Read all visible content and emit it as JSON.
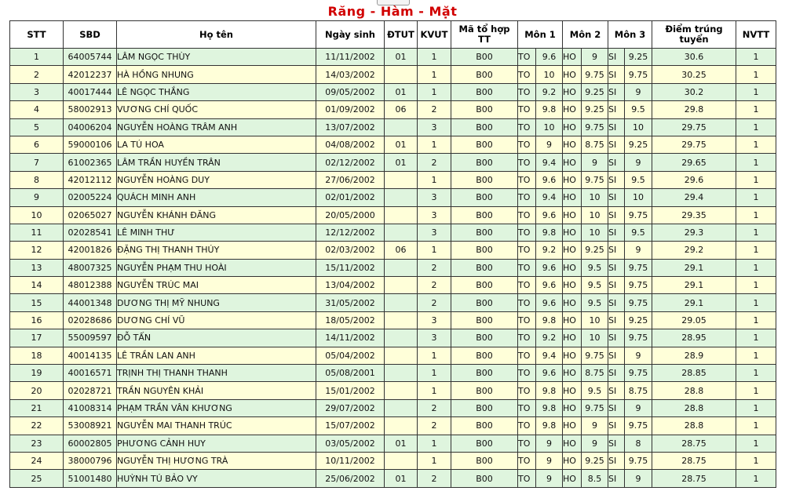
{
  "page": {
    "title": "Răng - Hàm - Mặt"
  },
  "table": {
    "headers": {
      "stt": "STT",
      "sbd": "SBD",
      "name": "Họ tên",
      "dob": "Ngày sinh",
      "dtut": "ĐTUT",
      "kvut": "KVUT",
      "combo": "Mã tổ hợp TT",
      "mon1": "Môn 1",
      "mon2": "Môn 2",
      "mon3": "Môn 3",
      "diem": "Điểm trúng tuyển",
      "nvtt": "NVTT"
    },
    "rows": [
      {
        "stt": "1",
        "sbd": "64005744",
        "name": "LÂM NGỌC THÙY",
        "dob": "11/11/2002",
        "dtut": "01",
        "kvut": "1",
        "combo": "B00",
        "m1": "TO",
        "s1": "9.6",
        "m2": "HO",
        "s2": "9",
        "m3": "SI",
        "s3": "9.25",
        "diem": "30.6",
        "nvtt": "1"
      },
      {
        "stt": "2",
        "sbd": "42012237",
        "name": "HÀ HỒNG NHUNG",
        "dob": "14/03/2002",
        "dtut": "",
        "kvut": "1",
        "combo": "B00",
        "m1": "TO",
        "s1": "10",
        "m2": "HO",
        "s2": "9.75",
        "m3": "SI",
        "s3": "9.75",
        "diem": "30.25",
        "nvtt": "1"
      },
      {
        "stt": "3",
        "sbd": "40017444",
        "name": "LÊ NGỌC THẮNG",
        "dob": "09/05/2002",
        "dtut": "01",
        "kvut": "1",
        "combo": "B00",
        "m1": "TO",
        "s1": "9.2",
        "m2": "HO",
        "s2": "9.25",
        "m3": "SI",
        "s3": "9",
        "diem": "30.2",
        "nvtt": "1"
      },
      {
        "stt": "4",
        "sbd": "58002913",
        "name": "VƯƠNG CHÍ QUỐC",
        "dob": "01/09/2002",
        "dtut": "06",
        "kvut": "2",
        "combo": "B00",
        "m1": "TO",
        "s1": "9.8",
        "m2": "HO",
        "s2": "9.25",
        "m3": "SI",
        "s3": "9.5",
        "diem": "29.8",
        "nvtt": "1"
      },
      {
        "stt": "5",
        "sbd": "04006204",
        "name": "NGUYỄN HOÀNG TRÂM ANH",
        "dob": "13/07/2002",
        "dtut": "",
        "kvut": "3",
        "combo": "B00",
        "m1": "TO",
        "s1": "10",
        "m2": "HO",
        "s2": "9.75",
        "m3": "SI",
        "s3": "10",
        "diem": "29.75",
        "nvtt": "1"
      },
      {
        "stt": "6",
        "sbd": "59000106",
        "name": "LA TÚ HOA",
        "dob": "04/08/2002",
        "dtut": "01",
        "kvut": "1",
        "combo": "B00",
        "m1": "TO",
        "s1": "9",
        "m2": "HO",
        "s2": "8.75",
        "m3": "SI",
        "s3": "9.25",
        "diem": "29.75",
        "nvtt": "1"
      },
      {
        "stt": "7",
        "sbd": "61002365",
        "name": "LÂM TRẦN HUYỀN TRÂN",
        "dob": "02/12/2002",
        "dtut": "01",
        "kvut": "2",
        "combo": "B00",
        "m1": "TO",
        "s1": "9.4",
        "m2": "HO",
        "s2": "9",
        "m3": "SI",
        "s3": "9",
        "diem": "29.65",
        "nvtt": "1"
      },
      {
        "stt": "8",
        "sbd": "42012112",
        "name": "NGUYỄN HOÀNG DUY",
        "dob": "27/06/2002",
        "dtut": "",
        "kvut": "1",
        "combo": "B00",
        "m1": "TO",
        "s1": "9.6",
        "m2": "HO",
        "s2": "9.75",
        "m3": "SI",
        "s3": "9.5",
        "diem": "29.6",
        "nvtt": "1"
      },
      {
        "stt": "9",
        "sbd": "02005224",
        "name": "QUÁCH MINH ANH",
        "dob": "02/01/2002",
        "dtut": "",
        "kvut": "3",
        "combo": "B00",
        "m1": "TO",
        "s1": "9.4",
        "m2": "HO",
        "s2": "10",
        "m3": "SI",
        "s3": "10",
        "diem": "29.4",
        "nvtt": "1"
      },
      {
        "stt": "10",
        "sbd": "02065027",
        "name": "NGUYỄN KHÁNH ĐĂNG",
        "dob": "20/05/2000",
        "dtut": "",
        "kvut": "3",
        "combo": "B00",
        "m1": "TO",
        "s1": "9.6",
        "m2": "HO",
        "s2": "10",
        "m3": "SI",
        "s3": "9.75",
        "diem": "29.35",
        "nvtt": "1"
      },
      {
        "stt": "11",
        "sbd": "02028541",
        "name": "LÊ MINH THƯ",
        "dob": "12/12/2002",
        "dtut": "",
        "kvut": "3",
        "combo": "B00",
        "m1": "TO",
        "s1": "9.8",
        "m2": "HO",
        "s2": "10",
        "m3": "SI",
        "s3": "9.5",
        "diem": "29.3",
        "nvtt": "1"
      },
      {
        "stt": "12",
        "sbd": "42001826",
        "name": "ĐẶNG THỊ THANH THÚY",
        "dob": "02/03/2002",
        "dtut": "06",
        "kvut": "1",
        "combo": "B00",
        "m1": "TO",
        "s1": "9.2",
        "m2": "HO",
        "s2": "9.25",
        "m3": "SI",
        "s3": "9",
        "diem": "29.2",
        "nvtt": "1"
      },
      {
        "stt": "13",
        "sbd": "48007325",
        "name": "NGUYỄN PHẠM THU HOÀI",
        "dob": "15/11/2002",
        "dtut": "",
        "kvut": "2",
        "combo": "B00",
        "m1": "TO",
        "s1": "9.6",
        "m2": "HO",
        "s2": "9.5",
        "m3": "SI",
        "s3": "9.75",
        "diem": "29.1",
        "nvtt": "1"
      },
      {
        "stt": "14",
        "sbd": "48012388",
        "name": "NGUYỄN TRÚC MAI",
        "dob": "13/04/2002",
        "dtut": "",
        "kvut": "2",
        "combo": "B00",
        "m1": "TO",
        "s1": "9.6",
        "m2": "HO",
        "s2": "9.5",
        "m3": "SI",
        "s3": "9.75",
        "diem": "29.1",
        "nvtt": "1"
      },
      {
        "stt": "15",
        "sbd": "44001348",
        "name": "DƯƠNG THỊ MỸ NHUNG",
        "dob": "31/05/2002",
        "dtut": "",
        "kvut": "2",
        "combo": "B00",
        "m1": "TO",
        "s1": "9.6",
        "m2": "HO",
        "s2": "9.5",
        "m3": "SI",
        "s3": "9.75",
        "diem": "29.1",
        "nvtt": "1"
      },
      {
        "stt": "16",
        "sbd": "02028686",
        "name": "DƯƠNG CHÍ VŨ",
        "dob": "18/05/2002",
        "dtut": "",
        "kvut": "3",
        "combo": "B00",
        "m1": "TO",
        "s1": "9.8",
        "m2": "HO",
        "s2": "10",
        "m3": "SI",
        "s3": "9.25",
        "diem": "29.05",
        "nvtt": "1"
      },
      {
        "stt": "17",
        "sbd": "55009597",
        "name": "ĐỖ TẤN",
        "dob": "14/11/2002",
        "dtut": "",
        "kvut": "3",
        "combo": "B00",
        "m1": "TO",
        "s1": "9.2",
        "m2": "HO",
        "s2": "10",
        "m3": "SI",
        "s3": "9.75",
        "diem": "28.95",
        "nvtt": "1"
      },
      {
        "stt": "18",
        "sbd": "40014135",
        "name": "LÊ TRẦN LAN ANH",
        "dob": "05/04/2002",
        "dtut": "",
        "kvut": "1",
        "combo": "B00",
        "m1": "TO",
        "s1": "9.4",
        "m2": "HO",
        "s2": "9.75",
        "m3": "SI",
        "s3": "9",
        "diem": "28.9",
        "nvtt": "1"
      },
      {
        "stt": "19",
        "sbd": "40016571",
        "name": "TRỊNH THỊ THANH THANH",
        "dob": "05/08/2001",
        "dtut": "",
        "kvut": "1",
        "combo": "B00",
        "m1": "TO",
        "s1": "9.6",
        "m2": "HO",
        "s2": "8.75",
        "m3": "SI",
        "s3": "9.75",
        "diem": "28.85",
        "nvtt": "1"
      },
      {
        "stt": "20",
        "sbd": "02028721",
        "name": "TRẦN NGUYÊN KHẢI",
        "dob": "15/01/2002",
        "dtut": "",
        "kvut": "1",
        "combo": "B00",
        "m1": "TO",
        "s1": "9.8",
        "m2": "HO",
        "s2": "9.5",
        "m3": "SI",
        "s3": "8.75",
        "diem": "28.8",
        "nvtt": "1"
      },
      {
        "stt": "21",
        "sbd": "41008314",
        "name": "PHẠM TRẦN VÂN KHƯƠNG",
        "dob": "29/07/2002",
        "dtut": "",
        "kvut": "2",
        "combo": "B00",
        "m1": "TO",
        "s1": "9.8",
        "m2": "HO",
        "s2": "9.75",
        "m3": "SI",
        "s3": "9",
        "diem": "28.8",
        "nvtt": "1"
      },
      {
        "stt": "22",
        "sbd": "53008921",
        "name": "NGUYỄN MAI THANH TRÚC",
        "dob": "15/07/2002",
        "dtut": "",
        "kvut": "2",
        "combo": "B00",
        "m1": "TO",
        "s1": "9.8",
        "m2": "HO",
        "s2": "9",
        "m3": "SI",
        "s3": "9.75",
        "diem": "28.8",
        "nvtt": "1"
      },
      {
        "stt": "23",
        "sbd": "60002805",
        "name": "PHƯƠNG CẢNH HUY",
        "dob": "03/05/2002",
        "dtut": "01",
        "kvut": "1",
        "combo": "B00",
        "m1": "TO",
        "s1": "9",
        "m2": "HO",
        "s2": "9",
        "m3": "SI",
        "s3": "8",
        "diem": "28.75",
        "nvtt": "1"
      },
      {
        "stt": "24",
        "sbd": "38000796",
        "name": "NGUYỄN THỊ HƯƠNG TRÀ",
        "dob": "10/11/2002",
        "dtut": "",
        "kvut": "1",
        "combo": "B00",
        "m1": "TO",
        "s1": "9",
        "m2": "HO",
        "s2": "9.25",
        "m3": "SI",
        "s3": "9.75",
        "diem": "28.75",
        "nvtt": "1"
      },
      {
        "stt": "25",
        "sbd": "51001480",
        "name": "HUỲNH TÚ BẢO VY",
        "dob": "25/06/2002",
        "dtut": "01",
        "kvut": "2",
        "combo": "B00",
        "m1": "TO",
        "s1": "9",
        "m2": "HO",
        "s2": "8.5",
        "m3": "SI",
        "s3": "9",
        "diem": "28.75",
        "nvtt": "1"
      }
    ]
  },
  "colors": {
    "title": "#d10000",
    "row_green": "#dff5de",
    "row_yellow": "#ffffd9",
    "border": "#333333"
  }
}
